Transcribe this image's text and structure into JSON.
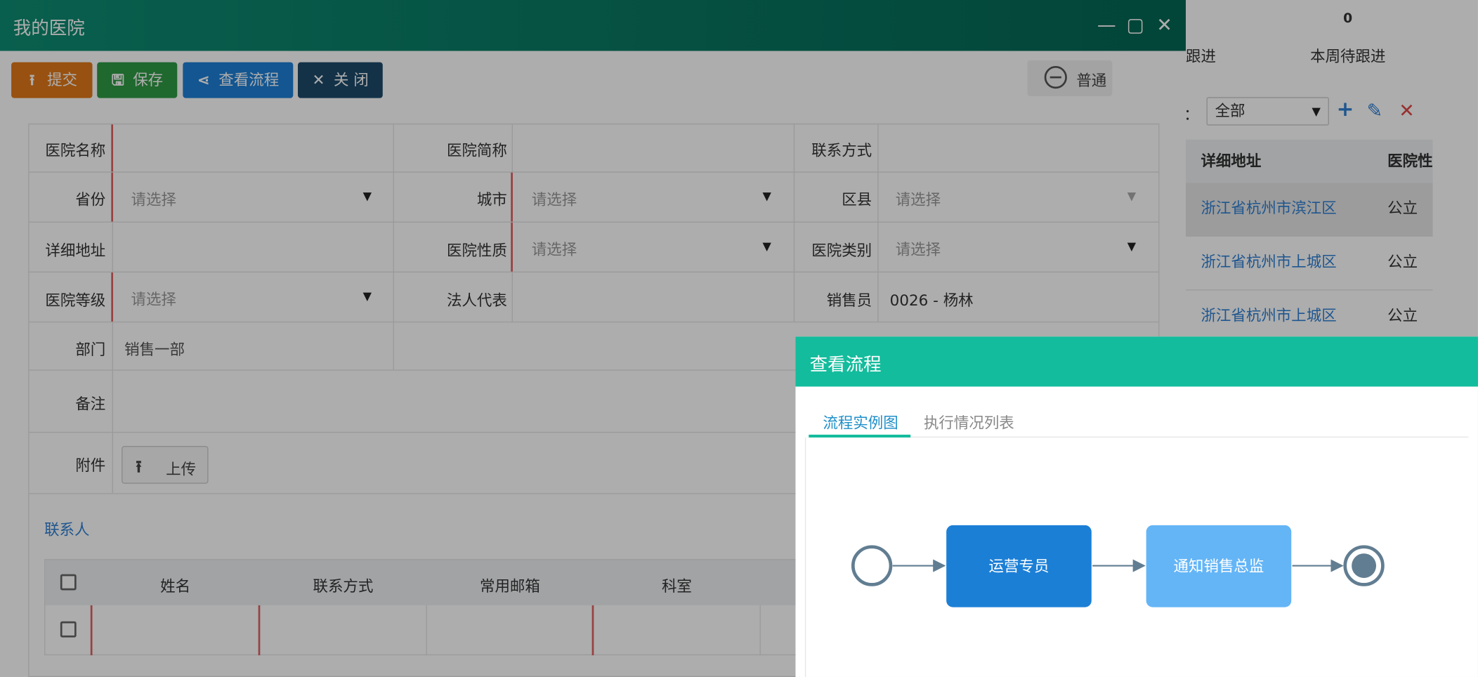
{
  "background": {
    "stat_value": "0",
    "labels": [
      "跟进",
      "本周待跟进"
    ],
    "filter_prefix": "：",
    "filter_value": "全部",
    "table_headers": [
      "详细地址",
      "医院性"
    ],
    "rows": [
      {
        "address": "浙江省杭州市滨江区",
        "nature": "公立"
      },
      {
        "address": "浙江省杭州市上城区",
        "nature": "公立"
      },
      {
        "address": "浙江省杭州市上城区",
        "nature": "公立"
      }
    ]
  },
  "window": {
    "title": "我的医院",
    "toolbar": {
      "submit": "提交",
      "save": "保存",
      "view_flow": "查看流程",
      "close": "关 闭"
    },
    "priority_label": "普通"
  },
  "form": {
    "labels": {
      "hospital_name": "医院名称",
      "short_name": "医院简称",
      "contact": "联系方式",
      "province": "省份",
      "city": "城市",
      "district": "区县",
      "address": "详细地址",
      "nature": "医院性质",
      "category": "医院类别",
      "level": "医院等级",
      "legal_rep": "法人代表",
      "salesperson": "销售员",
      "department": "部门",
      "remarks": "备注",
      "attachment": "附件"
    },
    "placeholder_select": "请选择",
    "salesperson_value": "0026 - 杨林",
    "department_value": "销售一部",
    "upload_label": "上传",
    "contacts_section": "联系人",
    "contact_columns": [
      "姓名",
      "联系方式",
      "常用邮箱",
      "科室"
    ]
  },
  "dialog": {
    "title": "查看流程",
    "tabs": [
      "流程实例图",
      "执行情况列表"
    ],
    "flow": {
      "nodes": [
        "运营专员",
        "通知销售总监"
      ],
      "colors": {
        "task_active": "#1c7fd6",
        "task_pending": "#64b5f6",
        "event_stroke": "#617d91",
        "arrow": "#617d91"
      }
    }
  }
}
